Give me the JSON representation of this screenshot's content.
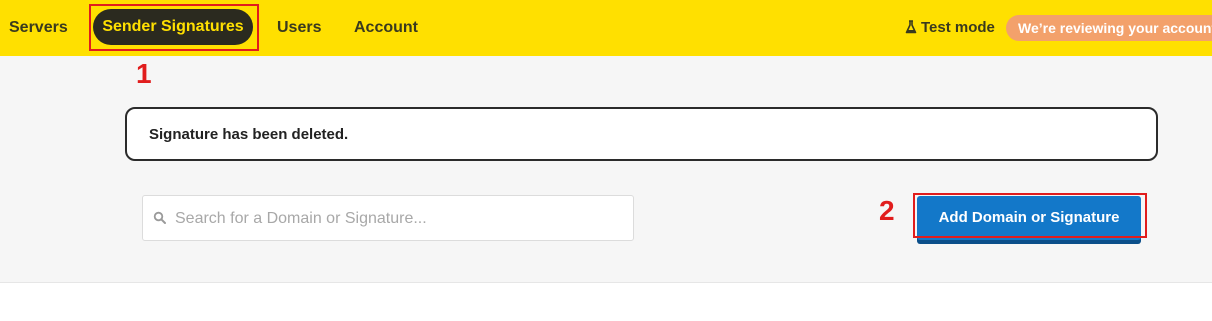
{
  "nav": {
    "items": [
      {
        "label": "Servers"
      },
      {
        "label": "Sender Signatures",
        "active": true
      },
      {
        "label": "Users"
      },
      {
        "label": "Account"
      }
    ],
    "test_mode_label": "Test mode",
    "test_mode_icon": "flask-icon",
    "review_badge": "We’re reviewing your account",
    "bg_color": "#FFE000"
  },
  "alert": {
    "message": "Signature has been deleted."
  },
  "search": {
    "placeholder": "Search for a Domain or Signature...",
    "value": "",
    "icon": "search-icon"
  },
  "actions": {
    "add_label": "Add Domain or Signature",
    "accent_color": "#1378c9"
  },
  "annotations": {
    "step1": "1",
    "step2": "2",
    "color": "#e11d1d"
  }
}
